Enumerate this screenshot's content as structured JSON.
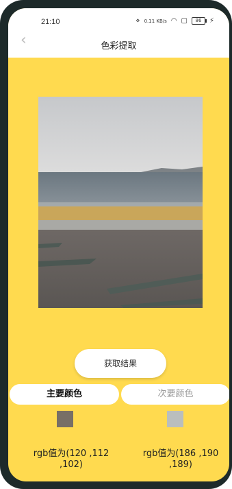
{
  "status": {
    "time": "21:10",
    "net_speed": "0.11 KB/s",
    "battery": "86"
  },
  "nav": {
    "back": "‹",
    "title": "色彩提取"
  },
  "button": {
    "label": "获取结果"
  },
  "tabs": {
    "main": "主要颜色",
    "secondary": "次要颜色",
    "active": "main"
  },
  "colors": {
    "primary": {
      "hex": "#786f66",
      "text": "rgb值为(120 ,112\n,102)"
    },
    "secondary": {
      "hex": "#babebd",
      "text": "rgb值为(186 ,190\n,189)"
    },
    "background": "#ffda4f"
  }
}
